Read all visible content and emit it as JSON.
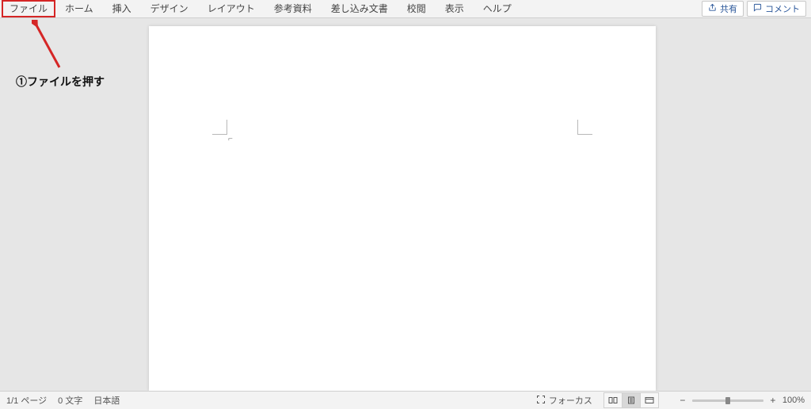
{
  "ribbon": {
    "tabs": [
      "ファイル",
      "ホーム",
      "挿入",
      "デザイン",
      "レイアウト",
      "参考資料",
      "差し込み文書",
      "校閲",
      "表示",
      "ヘルプ"
    ],
    "share_label": "共有",
    "comment_label": "コメント"
  },
  "annotation": {
    "text": "①ファイルを押す"
  },
  "statusbar": {
    "page": "1/1 ページ",
    "words": "0 文字",
    "language": "日本語",
    "focus": "フォーカス",
    "zoom_percent": "100%"
  }
}
